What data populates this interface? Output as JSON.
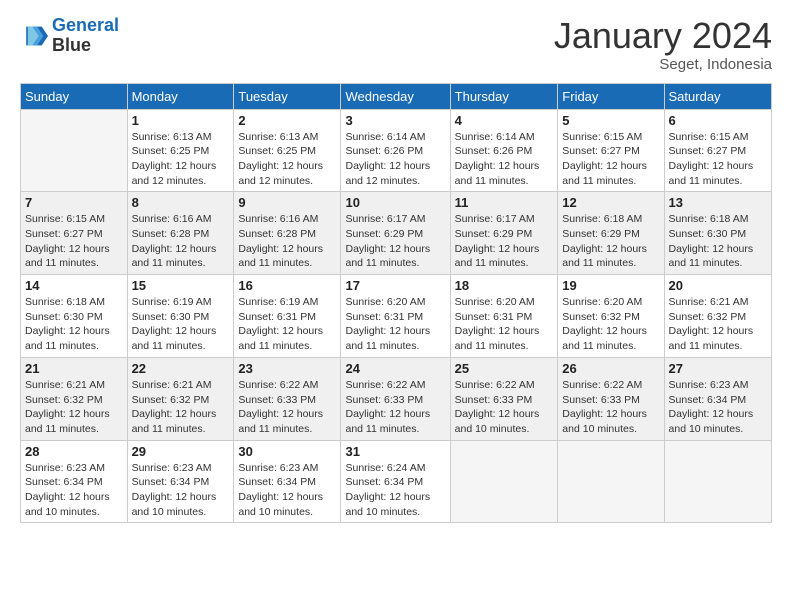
{
  "logo": {
    "line1": "General",
    "line2": "Blue"
  },
  "title": "January 2024",
  "subtitle": "Seget, Indonesia",
  "days_header": [
    "Sunday",
    "Monday",
    "Tuesday",
    "Wednesday",
    "Thursday",
    "Friday",
    "Saturday"
  ],
  "weeks": [
    [
      {
        "day": "",
        "info": ""
      },
      {
        "day": "1",
        "info": "Sunrise: 6:13 AM\nSunset: 6:25 PM\nDaylight: 12 hours\nand 12 minutes."
      },
      {
        "day": "2",
        "info": "Sunrise: 6:13 AM\nSunset: 6:25 PM\nDaylight: 12 hours\nand 12 minutes."
      },
      {
        "day": "3",
        "info": "Sunrise: 6:14 AM\nSunset: 6:26 PM\nDaylight: 12 hours\nand 12 minutes."
      },
      {
        "day": "4",
        "info": "Sunrise: 6:14 AM\nSunset: 6:26 PM\nDaylight: 12 hours\nand 11 minutes."
      },
      {
        "day": "5",
        "info": "Sunrise: 6:15 AM\nSunset: 6:27 PM\nDaylight: 12 hours\nand 11 minutes."
      },
      {
        "day": "6",
        "info": "Sunrise: 6:15 AM\nSunset: 6:27 PM\nDaylight: 12 hours\nand 11 minutes."
      }
    ],
    [
      {
        "day": "7",
        "info": "Sunrise: 6:15 AM\nSunset: 6:27 PM\nDaylight: 12 hours\nand 11 minutes."
      },
      {
        "day": "8",
        "info": "Sunrise: 6:16 AM\nSunset: 6:28 PM\nDaylight: 12 hours\nand 11 minutes."
      },
      {
        "day": "9",
        "info": "Sunrise: 6:16 AM\nSunset: 6:28 PM\nDaylight: 12 hours\nand 11 minutes."
      },
      {
        "day": "10",
        "info": "Sunrise: 6:17 AM\nSunset: 6:29 PM\nDaylight: 12 hours\nand 11 minutes."
      },
      {
        "day": "11",
        "info": "Sunrise: 6:17 AM\nSunset: 6:29 PM\nDaylight: 12 hours\nand 11 minutes."
      },
      {
        "day": "12",
        "info": "Sunrise: 6:18 AM\nSunset: 6:29 PM\nDaylight: 12 hours\nand 11 minutes."
      },
      {
        "day": "13",
        "info": "Sunrise: 6:18 AM\nSunset: 6:30 PM\nDaylight: 12 hours\nand 11 minutes."
      }
    ],
    [
      {
        "day": "14",
        "info": "Sunrise: 6:18 AM\nSunset: 6:30 PM\nDaylight: 12 hours\nand 11 minutes."
      },
      {
        "day": "15",
        "info": "Sunrise: 6:19 AM\nSunset: 6:30 PM\nDaylight: 12 hours\nand 11 minutes."
      },
      {
        "day": "16",
        "info": "Sunrise: 6:19 AM\nSunset: 6:31 PM\nDaylight: 12 hours\nand 11 minutes."
      },
      {
        "day": "17",
        "info": "Sunrise: 6:20 AM\nSunset: 6:31 PM\nDaylight: 12 hours\nand 11 minutes."
      },
      {
        "day": "18",
        "info": "Sunrise: 6:20 AM\nSunset: 6:31 PM\nDaylight: 12 hours\nand 11 minutes."
      },
      {
        "day": "19",
        "info": "Sunrise: 6:20 AM\nSunset: 6:32 PM\nDaylight: 12 hours\nand 11 minutes."
      },
      {
        "day": "20",
        "info": "Sunrise: 6:21 AM\nSunset: 6:32 PM\nDaylight: 12 hours\nand 11 minutes."
      }
    ],
    [
      {
        "day": "21",
        "info": "Sunrise: 6:21 AM\nSunset: 6:32 PM\nDaylight: 12 hours\nand 11 minutes."
      },
      {
        "day": "22",
        "info": "Sunrise: 6:21 AM\nSunset: 6:32 PM\nDaylight: 12 hours\nand 11 minutes."
      },
      {
        "day": "23",
        "info": "Sunrise: 6:22 AM\nSunset: 6:33 PM\nDaylight: 12 hours\nand 11 minutes."
      },
      {
        "day": "24",
        "info": "Sunrise: 6:22 AM\nSunset: 6:33 PM\nDaylight: 12 hours\nand 11 minutes."
      },
      {
        "day": "25",
        "info": "Sunrise: 6:22 AM\nSunset: 6:33 PM\nDaylight: 12 hours\nand 10 minutes."
      },
      {
        "day": "26",
        "info": "Sunrise: 6:22 AM\nSunset: 6:33 PM\nDaylight: 12 hours\nand 10 minutes."
      },
      {
        "day": "27",
        "info": "Sunrise: 6:23 AM\nSunset: 6:34 PM\nDaylight: 12 hours\nand 10 minutes."
      }
    ],
    [
      {
        "day": "28",
        "info": "Sunrise: 6:23 AM\nSunset: 6:34 PM\nDaylight: 12 hours\nand 10 minutes."
      },
      {
        "day": "29",
        "info": "Sunrise: 6:23 AM\nSunset: 6:34 PM\nDaylight: 12 hours\nand 10 minutes."
      },
      {
        "day": "30",
        "info": "Sunrise: 6:23 AM\nSunset: 6:34 PM\nDaylight: 12 hours\nand 10 minutes."
      },
      {
        "day": "31",
        "info": "Sunrise: 6:24 AM\nSunset: 6:34 PM\nDaylight: 12 hours\nand 10 minutes."
      },
      {
        "day": "",
        "info": ""
      },
      {
        "day": "",
        "info": ""
      },
      {
        "day": "",
        "info": ""
      }
    ]
  ]
}
